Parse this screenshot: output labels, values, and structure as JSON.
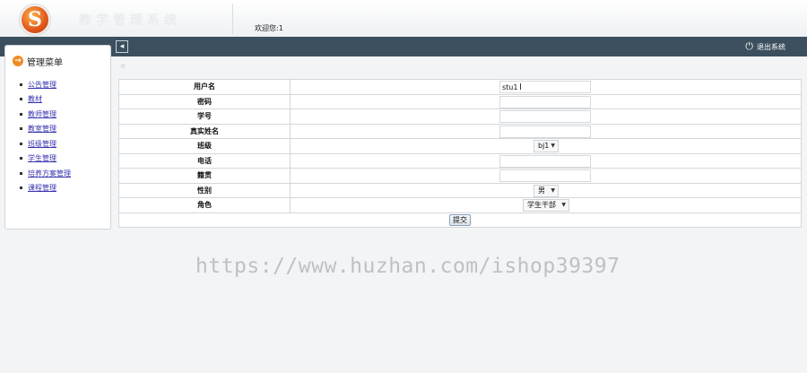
{
  "header": {
    "logo_letter": "S",
    "system_title": "教学管理系统",
    "welcome_text": "欢迎您:1"
  },
  "navbar": {
    "collapse_icon": "collapse-left-icon",
    "logout_label": "退出系统",
    "logout_icon": "power-icon"
  },
  "sidebar": {
    "title": "管理菜单",
    "items": [
      {
        "label": "公告管理"
      },
      {
        "label": "教材"
      },
      {
        "label": "教师管理"
      },
      {
        "label": "教室管理"
      },
      {
        "label": "班级管理"
      },
      {
        "label": "学生管理"
      },
      {
        "label": "培养方案管理"
      },
      {
        "label": "课程管理"
      }
    ]
  },
  "form": {
    "username_label": "用户名",
    "username_value": "stu1",
    "password_label": "密码",
    "password_value": "",
    "student_no_label": "学号",
    "student_no_value": "",
    "real_name_label": "真实姓名",
    "real_name_value": "",
    "class_label": "班级",
    "class_value": "bj1",
    "phone_label": "电话",
    "phone_value": "",
    "native_label": "籍贯",
    "native_value": "",
    "gender_label": "性别",
    "gender_value": "男",
    "role_label": "角色",
    "role_value": "学生干部",
    "submit_label": "提交"
  },
  "watermark": "https://www.huzhan.com/ishop39397",
  "colors": {
    "navbar_bg": "#3b4f5e",
    "link": "#3a35b0",
    "logo": "#e0561b"
  }
}
